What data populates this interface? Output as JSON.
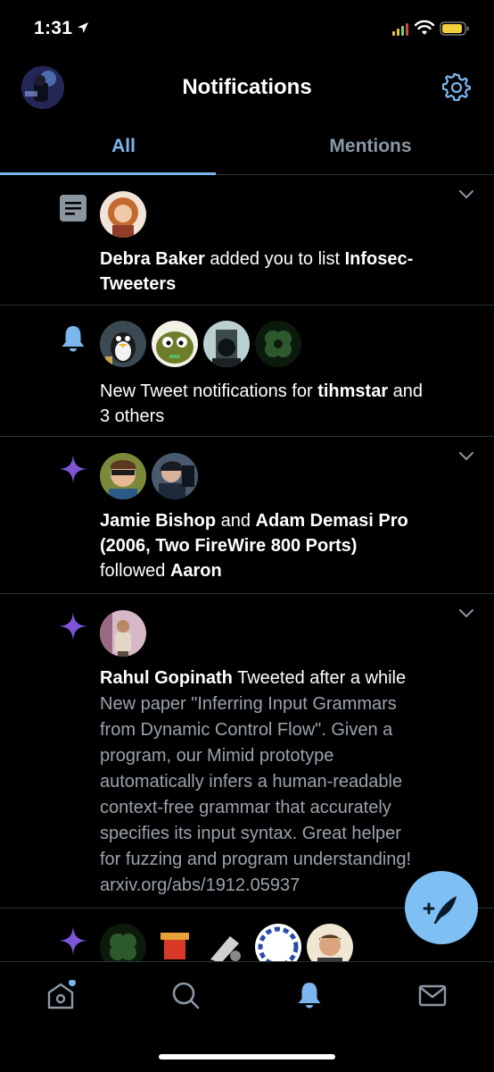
{
  "status_bar": {
    "time": "1:31"
  },
  "header": {
    "title": "Notifications"
  },
  "tabs": [
    {
      "label": "All",
      "active": true
    },
    {
      "label": "Mentions",
      "active": false
    }
  ],
  "notifications": [
    {
      "type": "list-add",
      "icon": "list-icon",
      "segments": [
        {
          "text": "Debra Baker",
          "bold": true
        },
        {
          "text": " added you to list ",
          "bold": false
        },
        {
          "text": "Infosec-Tweeters",
          "bold": true
        }
      ],
      "line1": {
        "name": "Debra Baker",
        "mid": " added you to list ",
        "target": "Infosec-"
      },
      "line2": "Tweeters"
    },
    {
      "type": "tweet-notifications",
      "icon": "bell-icon",
      "pre": "New Tweet notifications for ",
      "name": "tihmstar",
      "post": " and",
      "line2": "3 others"
    },
    {
      "type": "follow",
      "icon": "sparkle-icon",
      "name1": "Jamie Bishop",
      "and": " and ",
      "name2a": "Adam Demasi Pro",
      "name2b": "(2006, Two FireWire 800 Ports)",
      "followed": "followed ",
      "target": "Aaron"
    },
    {
      "type": "tweet",
      "icon": "sparkle-icon",
      "name": "Rahul Gopinath",
      "action": " Tweeted after a while",
      "tweet_lines": [
        "New paper \"Inferring Input Grammars",
        "from Dynamic Control Flow\". Given a",
        "program, our Mimid prototype",
        "automatically infers a human-readable",
        "context-free grammar that accurately",
        "specifies its input syntax.  Great helper",
        "for fuzzing and program understanding!",
        "arxiv.org/abs/1912.05937"
      ]
    },
    {
      "type": "follow-partial",
      "icon": "sparkle-icon"
    }
  ],
  "bottom_nav": [
    {
      "name": "home-icon",
      "badge": true
    },
    {
      "name": "search-icon",
      "badge": false
    },
    {
      "name": "notifications-icon",
      "active": true
    },
    {
      "name": "messages-icon",
      "badge": false
    }
  ],
  "colors": {
    "accent": "#7bb6ee",
    "sparkle": "#7d56d8",
    "fab": "#7ec0f4"
  }
}
